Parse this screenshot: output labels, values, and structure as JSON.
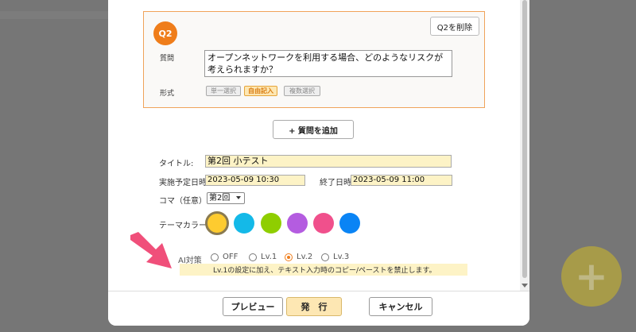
{
  "question": {
    "badge": "Q2",
    "delete_label": "Q2を削除",
    "question_label": "質問",
    "question_text": "オープンネットワークを利用する場合、どのようなリスクが考えられますか？",
    "format_label": "形式",
    "formats": [
      "単一選択",
      "自由記入",
      "複数選択"
    ],
    "selected_format": "自由記入"
  },
  "add_question_label": "+ 質問を追加",
  "form": {
    "title_label": "タイトル:",
    "title_value": "第2回 小テスト",
    "start_label": "実施予定日時:",
    "start_value": "2023-05-09 10:30",
    "end_label": "終了日時:",
    "end_value": "2023-05-09 11:00",
    "koma_label": "コマ（任意）:",
    "koma_value": "第2回",
    "theme_label": "テーマカラー:",
    "theme_colors": [
      "#fecb2f",
      "#14b9e8",
      "#8fce00",
      "#b45ce0",
      "#f0508c",
      "#0a84f5"
    ],
    "ai_label": "AI対策",
    "ai_options": [
      "OFF",
      "Lv.1",
      "Lv.2",
      "Lv.3"
    ],
    "ai_selected": "Lv.2",
    "ai_notice": "Lv.1の設定に加え、テキスト入力時のコピー/ペーストを禁止します。"
  },
  "footer": {
    "preview_label": "プレビュー",
    "publish_label": "発　行",
    "cancel_label": "キャンセル"
  },
  "fab_icon": "plus-icon",
  "accent_color": "#ef7d1a",
  "arrow_color": "#f04f7a"
}
